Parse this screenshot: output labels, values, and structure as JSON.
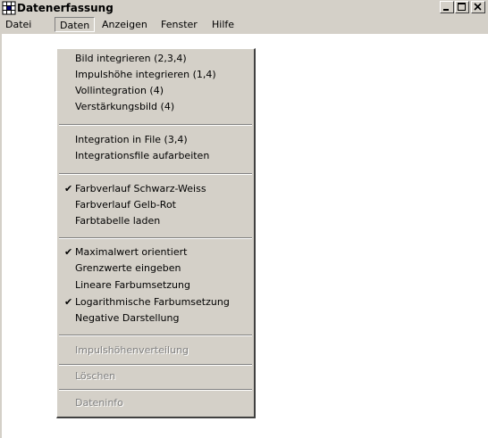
{
  "window": {
    "title": "Datenerfassung"
  },
  "menubar": {
    "items": [
      {
        "label": "Datei"
      },
      {
        "label": "Daten"
      },
      {
        "label": "Anzeigen"
      },
      {
        "label": "Fenster"
      },
      {
        "label": "Hilfe"
      }
    ]
  },
  "menu": {
    "items": [
      {
        "label": "Bild integrieren (2,3,4)",
        "checked": false,
        "enabled": true
      },
      {
        "label": "Impulshöhe integrieren (1,4)",
        "checked": false,
        "enabled": true
      },
      {
        "label": "Vollintegration (4)",
        "checked": false,
        "enabled": true
      },
      {
        "label": "Verstärkungsbild (4)",
        "checked": false,
        "enabled": true
      },
      {
        "label": "Integration in File (3,4)",
        "checked": false,
        "enabled": true
      },
      {
        "label": "Integrationsfile aufarbeiten",
        "checked": false,
        "enabled": true
      },
      {
        "label": "Farbverlauf Schwarz-Weiss",
        "checked": true,
        "enabled": true
      },
      {
        "label": "Farbverlauf Gelb-Rot",
        "checked": false,
        "enabled": true
      },
      {
        "label": "Farbtabelle laden",
        "checked": false,
        "enabled": true
      },
      {
        "label": "Maximalwert orientiert",
        "checked": true,
        "enabled": true
      },
      {
        "label": "Grenzwerte eingeben",
        "checked": false,
        "enabled": true
      },
      {
        "label": "Lineare Farbumsetzung",
        "checked": false,
        "enabled": true
      },
      {
        "label": "Logarithmische Farbumsetzung",
        "checked": true,
        "enabled": true
      },
      {
        "label": "Negative Darstellung",
        "checked": false,
        "enabled": true
      },
      {
        "label": "Impulshöhenverteilung",
        "checked": false,
        "enabled": false
      },
      {
        "label": "Löschen",
        "checked": false,
        "enabled": false
      },
      {
        "label": "Dateninfo",
        "checked": false,
        "enabled": false
      }
    ]
  },
  "icons": {
    "app": "grid-app-icon",
    "minimize": "minimize-icon",
    "maximize": "maximize-icon",
    "close": "close-icon",
    "check": "checkmark-icon"
  }
}
